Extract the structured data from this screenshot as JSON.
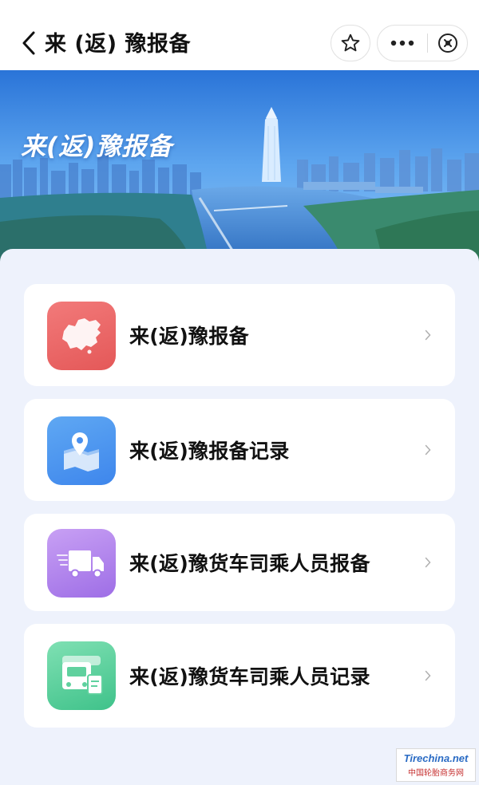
{
  "nav": {
    "title": "来 (返) 豫报备"
  },
  "banner": {
    "title": "来(返)豫报备"
  },
  "cards": [
    {
      "label": "来(返)豫报备",
      "icon": "china-map-icon"
    },
    {
      "label": "来(返)豫报备记录",
      "icon": "map-pin-icon"
    },
    {
      "label": "来(返)豫货车司乘人员报备",
      "icon": "truck-icon"
    },
    {
      "label": "来(返)豫货车司乘人员记录",
      "icon": "truck-driver-record-icon"
    }
  ],
  "watermark": {
    "logo": "Tirechina.net",
    "text": "中国轮胎商务网"
  },
  "colors": {
    "red_icon": "#e45858",
    "blue_icon": "#3e86ec",
    "purple_icon": "#9e6ee6",
    "green_icon": "#3fc28a",
    "panel_bg": "#eef2fc"
  }
}
